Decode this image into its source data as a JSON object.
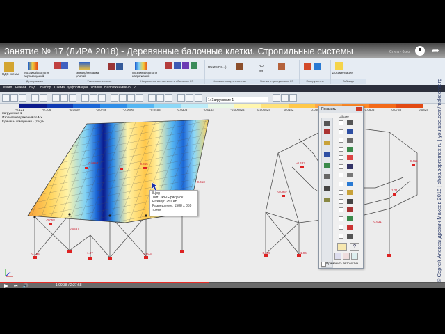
{
  "video": {
    "title": "Занятие № 17 (ЛИРА 2018) - Деревянные балочные клетки. Стропильные системы",
    "top_right_text": "Стиль · 0кно",
    "progress": 0.47,
    "time_text": "1:09:38 / 2:27:58"
  },
  "ribbon": {
    "groups": [
      {
        "caption": "Деформации",
        "labels": [
          "НДС схемы",
          "Мозаика/изополя перемещений"
        ]
      },
      {
        "caption": "Усилия в стержнях",
        "labels": [
          "Эпюры/мозаика усилий"
        ]
      },
      {
        "caption": "Напряжения в пластинах и объемных КЭ",
        "labels": [
          "Мозаика/изополя напряжений"
        ]
      },
      {
        "caption": "Усилия в спец. элементах",
        "labels": [
          "RU(ZS,RS...)"
        ]
      },
      {
        "caption": "Усилия в одноузловых КЭ",
        "labels": [
          "RO",
          "RP"
        ]
      },
      {
        "caption": "Инструменты",
        "labels": []
      },
      {
        "caption": "Таблицы",
        "labels": [
          "Документация"
        ]
      }
    ]
  },
  "menu": [
    "Файл",
    "Режим",
    "Вид",
    "Выбор",
    "Схема",
    "Деформации",
    "Усилия",
    "Напряжения",
    "Окно",
    "?"
  ],
  "toolbar": {
    "load_case": "1: Загружение 1"
  },
  "legend": {
    "ticks": [
      "-0.121",
      "-0.106",
      "-0.0909",
      "-0.0758",
      "-0.0606",
      "-0.0453",
      "-0.0303",
      "-0.0152",
      "-0.000824",
      "0.000824",
      "0.0152",
      "0.0303",
      "0.0453",
      "0.0606",
      "0.0758",
      "0.0824"
    ],
    "colors": [
      "#0b1a8c",
      "#0f3ab2",
      "#1b66d6",
      "#2f8ee8",
      "#56b6f2",
      "#8dd8f7",
      "#bcebf8",
      "#e9f7e5",
      "#fff6b0",
      "#ffe27a",
      "#ffc84a",
      "#ffa64a",
      "#ff8a2a",
      "#f36a1a",
      "#e24a14"
    ]
  },
  "info": {
    "line1": "Загружение 1",
    "line2": "Изополя напряжений по Mx",
    "line3": "Единицы измерения - (т*м)/м"
  },
  "model": {
    "left_labels": [
      "-0.0953",
      "-0.065",
      "-0.058",
      "0.0467",
      "1.07",
      "-0.413",
      "-0.013",
      "-0.154"
    ],
    "right_labels": [
      "-0.433",
      "-0.0937",
      "-0.415",
      "1.21",
      "-0.631",
      "1.96",
      "-0.215"
    ]
  },
  "tooltip": {
    "line1": "8.jpg",
    "line2": "Тип: JPEG-рисунок",
    "line3": "Размер: 250 КБ",
    "line4": "Разрешение: 1588 x 859",
    "line5": "точек"
  },
  "show_panel": {
    "title": "Показать",
    "section": "Общие",
    "apply_label": "Применить автоматич"
  },
  "credit": "© Сергей Александрович Макеев 2018 | shop.sopromex.ru | youtube.com/makeevserg"
}
